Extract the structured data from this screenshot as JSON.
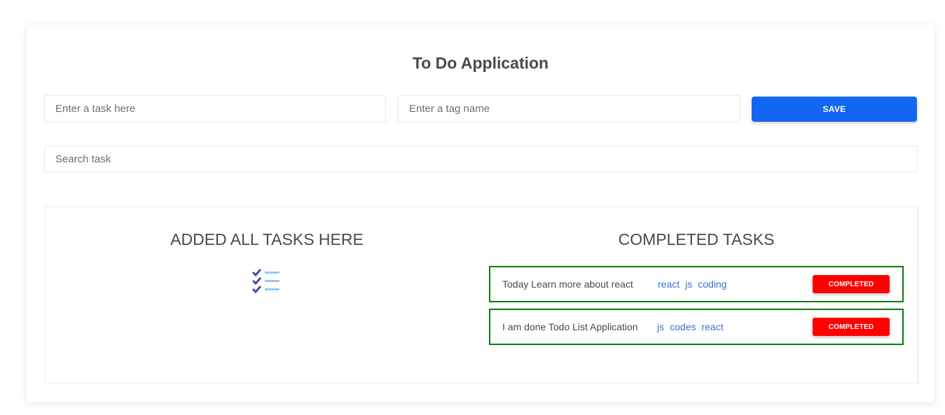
{
  "app": {
    "title": "To Do Application"
  },
  "form": {
    "task_placeholder": "Enter a task here",
    "tag_placeholder": "Enter a tag name",
    "save_label": "SAVE",
    "search_placeholder": "Search task"
  },
  "columns": {
    "added_title": "ADDED ALL TASKS HERE",
    "added_icon": "checklist-icon",
    "completed_title": "COMPLETED TASKS"
  },
  "completed_tasks": [
    {
      "text": "Today Learn more about react",
      "tags": [
        "react",
        "js",
        "coding"
      ],
      "button": "COMPLETED"
    },
    {
      "text": "I am done Todo List Application",
      "tags": [
        "js",
        "codes",
        "react"
      ],
      "button": "COMPLETED"
    }
  ],
  "colors": {
    "primary": "#1266f1",
    "danger": "#ff0000",
    "completed_border": "#0b7a0b",
    "tag_link": "#3a6fcf",
    "icon_check": "#3f4fa8",
    "icon_line": "#90caf9"
  }
}
